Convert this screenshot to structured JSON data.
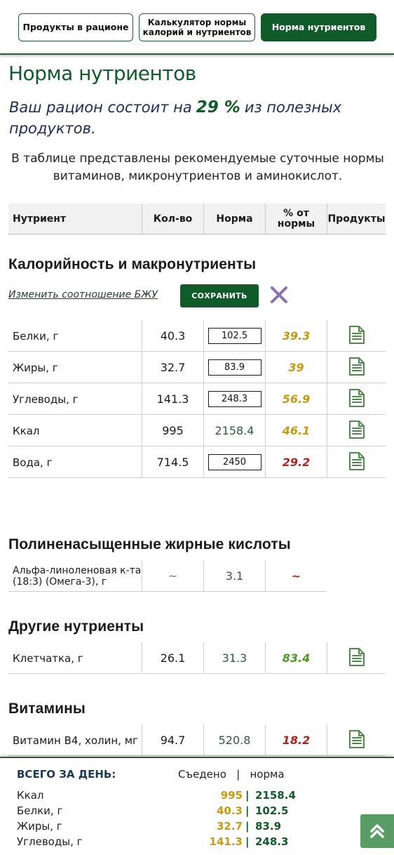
{
  "tabs": [
    {
      "label": "Продукты в рационе"
    },
    {
      "label": "Калькулятор нормы калорий и нутриентов"
    },
    {
      "label": "Норма нутриентов"
    }
  ],
  "page_title": "Норма нутриентов",
  "intro": {
    "prefix": "Ваш рацион состоит на",
    "percent": "29 %",
    "suffix": "из полезных продуктов."
  },
  "description": "В таблице представлены рекомендуемые суточные нормы витаминов, микронутриентов и аминокислот.",
  "table_header": {
    "nutrient": "Нутриент",
    "amount": "Кол-во",
    "norm": "Норма",
    "percent": "% от нормы",
    "products": "Продукты"
  },
  "sections": {
    "macro": {
      "title": "Калорийность и макронутриенты",
      "bju_link": "Изменить соотношение БЖУ",
      "save_label": "СОХРАНИТЬ",
      "rows": [
        {
          "name": "Белки, г",
          "amount": "40.3",
          "norm": "102.5",
          "percent": "39.3",
          "status": "orange",
          "editable": true
        },
        {
          "name": "Жиры, г",
          "amount": "32.7",
          "norm": "83.9",
          "percent": "39",
          "status": "orange",
          "editable": true
        },
        {
          "name": "Углеводы, г",
          "amount": "141.3",
          "norm": "248.3",
          "percent": "56.9",
          "status": "orange",
          "editable": true
        },
        {
          "name": "Ккал",
          "amount": "995",
          "norm": "2158.4",
          "percent": "46.1",
          "status": "orange",
          "editable": false
        },
        {
          "name": "Вода, г",
          "amount": "714.5",
          "norm": "2450",
          "percent": "29.2",
          "status": "red",
          "editable": true
        }
      ]
    },
    "pufa": {
      "title": "Полиненасыщенные жирные кислоты",
      "rows": [
        {
          "name": "Альфа-линоленовая к-та (18:3) (Омега-3), г",
          "amount": "~",
          "norm": "3.1",
          "percent": "~",
          "status": "red"
        }
      ]
    },
    "other": {
      "title": "Другие нутриенты",
      "rows": [
        {
          "name": "Клетчатка, г",
          "amount": "26.1",
          "norm": "31.3",
          "percent": "83.4",
          "status": "green"
        }
      ]
    },
    "vitamins": {
      "title": "Витамины",
      "rows": [
        {
          "name": "Витамин В4, холин, мг",
          "amount": "94.7",
          "norm": "520.8",
          "percent": "18.2",
          "status": "red"
        }
      ]
    }
  },
  "summary": {
    "title": "ВСЕГО ЗА ДЕНЬ:",
    "head": "Съедено   |   норма",
    "rows": [
      {
        "label": "Ккал",
        "eaten": "995",
        "norm": "2158.4"
      },
      {
        "label": "Белки, г",
        "eaten": "40.3",
        "norm": "102.5"
      },
      {
        "label": "Жиры, г",
        "eaten": "32.7",
        "norm": "83.9"
      },
      {
        "label": "Углеводы, г",
        "eaten": "141.3",
        "norm": "248.3"
      }
    ],
    "separator": "|"
  },
  "icons": {
    "products": "document-list-icon",
    "close": "close-x-icon",
    "scroll_up": "double-chevron-up-icon"
  },
  "colors": {
    "brand": "#0f5c2a",
    "orange": "#c99a0e",
    "red": "#b3211b",
    "green": "#4f9a1c",
    "close": "#8a72b0"
  }
}
